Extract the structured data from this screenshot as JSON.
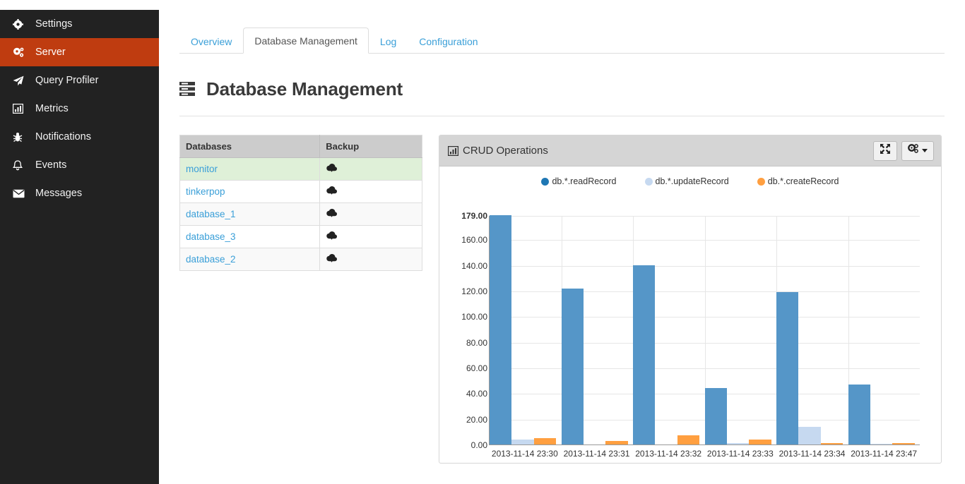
{
  "sidebar": {
    "items": [
      {
        "label": "Settings",
        "icon": "gear-icon",
        "active": false
      },
      {
        "label": "Server",
        "icon": "gears-icon",
        "active": true
      },
      {
        "label": "Query Profiler",
        "icon": "paper-plane-icon",
        "active": false
      },
      {
        "label": "Metrics",
        "icon": "bar-chart-icon",
        "active": false
      },
      {
        "label": "Notifications",
        "icon": "bug-icon",
        "active": false
      },
      {
        "label": "Events",
        "icon": "bell-icon",
        "active": false
      },
      {
        "label": "Messages",
        "icon": "envelope-icon",
        "active": false
      }
    ]
  },
  "tabs": [
    {
      "label": "Overview",
      "active": false
    },
    {
      "label": "Database Management",
      "active": true
    },
    {
      "label": "Log",
      "active": false
    },
    {
      "label": "Configuration",
      "active": false
    }
  ],
  "page": {
    "title": "Database Management",
    "title_icon": "server-list-icon"
  },
  "databases_table": {
    "columns": [
      "Databases",
      "Backup"
    ],
    "backup_icon": "cloud-download-icon",
    "rows": [
      {
        "name": "monitor",
        "highlight": true
      },
      {
        "name": "tinkerpop",
        "highlight": false
      },
      {
        "name": "database_1",
        "highlight": false
      },
      {
        "name": "database_3",
        "highlight": false
      },
      {
        "name": "database_2",
        "highlight": false
      }
    ]
  },
  "chart_panel": {
    "title": "CRUD Operations",
    "title_icon": "bar-chart-icon",
    "expand_button_icon": "expand-arrows-icon",
    "settings_button_icon": "gears-icon"
  },
  "colors": {
    "read": "#5596c8",
    "read_legend": "#1f77b4",
    "update": "#c6d9f0",
    "create": "#ff9f40",
    "sidebar_bg": "#222222",
    "active_nav": "#bf3c10",
    "link": "#3a9fd8"
  },
  "chart_data": {
    "type": "bar",
    "title": "CRUD Operations",
    "xlabel": "",
    "ylabel": "",
    "ylim": [
      0,
      179
    ],
    "grid": true,
    "legend_position": "top-center",
    "yticks": [
      "0.00",
      "20.00",
      "40.00",
      "60.00",
      "80.00",
      "100.00",
      "120.00",
      "140.00",
      "160.00",
      "179.00"
    ],
    "ytick_values": [
      0,
      20,
      40,
      60,
      80,
      100,
      120,
      140,
      160,
      179
    ],
    "categories": [
      "2013-11-14 23:30",
      "2013-11-14 23:31",
      "2013-11-14 23:32",
      "2013-11-14 23:33",
      "2013-11-14 23:34",
      "2013-11-14 23:47"
    ],
    "series": [
      {
        "name": "db.*.readRecord",
        "color": "#5596c8",
        "values": [
          179,
          122,
          140,
          44,
          119,
          47
        ]
      },
      {
        "name": "db.*.updateRecord",
        "color": "#c6d9f0",
        "values": [
          4,
          0,
          0,
          1,
          14,
          0.5
        ]
      },
      {
        "name": "db.*.createRecord",
        "color": "#ff9f40",
        "values": [
          5,
          3,
          7,
          4,
          1,
          1
        ]
      }
    ]
  }
}
